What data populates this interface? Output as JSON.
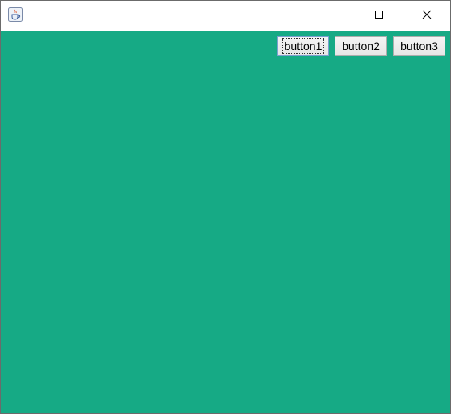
{
  "window": {
    "title": "",
    "content_background": "#16aa85",
    "icon": "java-cup-icon",
    "controls": {
      "minimize_icon": "minimize-icon",
      "maximize_icon": "maximize-icon",
      "close_icon": "close-icon"
    }
  },
  "buttons": [
    {
      "label": "button1",
      "focused": true
    },
    {
      "label": "button2",
      "focused": false
    },
    {
      "label": "button3",
      "focused": false
    }
  ]
}
